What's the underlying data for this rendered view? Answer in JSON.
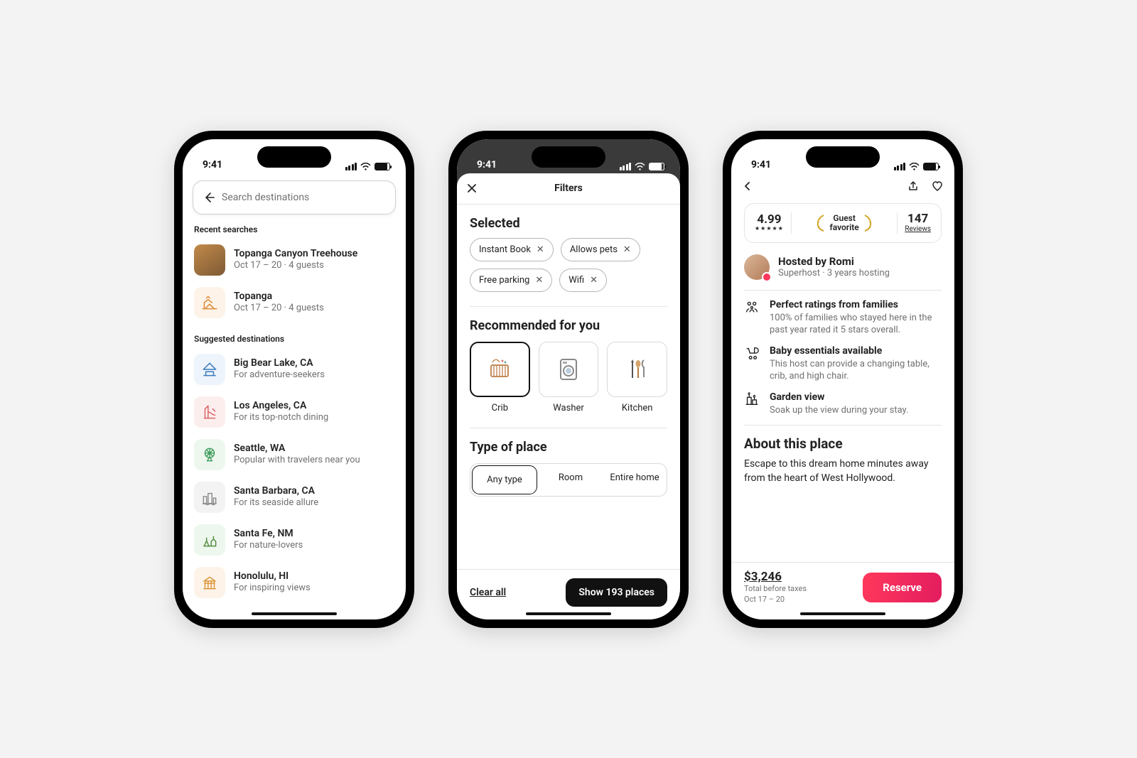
{
  "status": {
    "time": "9:41"
  },
  "phone1": {
    "search_placeholder": "Search destinations",
    "recent_header": "Recent searches",
    "recent": [
      {
        "title": "Topanga Canyon Treehouse",
        "sub": "Oct 17 – 20 · 4 guests"
      },
      {
        "title": "Topanga",
        "sub": "Oct 17 – 20 · 4 guests"
      }
    ],
    "suggested_header": "Suggested destinations",
    "suggested": [
      {
        "title": "Big Bear Lake, CA",
        "sub": "For adventure-seekers"
      },
      {
        "title": "Los Angeles, CA",
        "sub": "For its top-notch dining"
      },
      {
        "title": "Seattle, WA",
        "sub": "Popular with travelers near you"
      },
      {
        "title": "Santa Barbara, CA",
        "sub": "For its seaside allure"
      },
      {
        "title": "Santa Fe, NM",
        "sub": "For nature-lovers"
      },
      {
        "title": "Honolulu, HI",
        "sub": "For inspiring views"
      }
    ]
  },
  "phone2": {
    "title": "Filters",
    "selected_header": "Selected",
    "selected": [
      "Instant Book",
      "Allows pets",
      "Free parking",
      "Wifi"
    ],
    "rec_header": "Recommended for you",
    "rec": [
      "Crib",
      "Washer",
      "Kitchen"
    ],
    "type_header": "Type of place",
    "type_options": [
      "Any type",
      "Room",
      "Entire home"
    ],
    "clear": "Clear all",
    "show": "Show 193 places"
  },
  "phone3": {
    "rating_value": "4.99",
    "rating_stars": "★★★★★",
    "favorite_line1": "Guest",
    "favorite_line2": "favorite",
    "reviews_count": "147",
    "reviews_label": "Reviews",
    "host_title": "Hosted by Romi",
    "host_sub": "Superhost · 3 years hosting",
    "features": [
      {
        "title": "Perfect ratings from families",
        "sub": "100% of families who stayed here in the past year rated it 5 stars overall."
      },
      {
        "title": "Baby essentials available",
        "sub": "This host can provide a changing table, crib, and high chair."
      },
      {
        "title": "Garden view",
        "sub": "Soak up the view during your stay."
      }
    ],
    "about_header": "About this place",
    "about_body": "Escape to this dream home minutes away from the heart of West Hollywood.",
    "price": "$3,246",
    "price_sub": "Total before taxes",
    "dates": "Oct 17 – 20",
    "reserve": "Reserve"
  }
}
